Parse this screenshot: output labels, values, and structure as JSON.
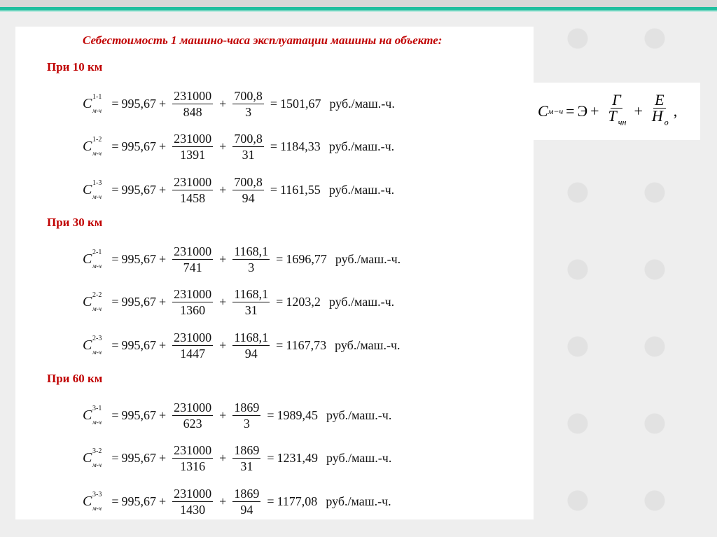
{
  "title": "Себестоимость 1 машино-часа эксплуатации машины на объекте:",
  "subscript": "м-ч",
  "unit": "руб./маш.-ч.",
  "general_formula": {
    "lhs": "C",
    "lhs_sub": "м−ч",
    "e": "Э",
    "g": "Г",
    "t": "T",
    "t_sub": "чн",
    "ee": "E",
    "h": "H",
    "h_sub": "о"
  },
  "groups": [
    {
      "heading": "При 10 км",
      "rows": [
        {
          "sup": "1-1",
          "a": "995,67",
          "n1": "231000",
          "d1": "848",
          "n2": "700,8",
          "d2": "3",
          "result": "1501,67"
        },
        {
          "sup": "1-2",
          "a": "995,67",
          "n1": "231000",
          "d1": "1391",
          "n2": "700,8",
          "d2": "31",
          "result": "1184,33"
        },
        {
          "sup": "1-3",
          "a": "995,67",
          "n1": "231000",
          "d1": "1458",
          "n2": "700,8",
          "d2": "94",
          "result": "1161,55"
        }
      ]
    },
    {
      "heading": "При 30 км",
      "rows": [
        {
          "sup": "2-1",
          "a": "995,67",
          "n1": "231000",
          "d1": "741",
          "n2": "1168,1",
          "d2": "3",
          "result": "1696,77"
        },
        {
          "sup": "2-2",
          "a": "995,67",
          "n1": "231000",
          "d1": "1360",
          "n2": "1168,1",
          "d2": "31",
          "result": "1203,2"
        },
        {
          "sup": "2-3",
          "a": "995,67",
          "n1": "231000",
          "d1": "1447",
          "n2": "1168,1",
          "d2": "94",
          "result": "1167,73"
        }
      ]
    },
    {
      "heading": "При 60 км",
      "rows": [
        {
          "sup": "3-1",
          "a": "995,67",
          "n1": "231000",
          "d1": "623",
          "n2": "1869",
          "d2": "3",
          "result": "1989,45"
        },
        {
          "sup": "3-2",
          "a": "995,67",
          "n1": "231000",
          "d1": "1316",
          "n2": "1869",
          "d2": "31",
          "result": "1231,49"
        },
        {
          "sup": "3-3",
          "a": "995,67",
          "n1": "231000",
          "d1": "1430",
          "n2": "1869",
          "d2": "94",
          "result": "1177,08"
        }
      ]
    }
  ]
}
